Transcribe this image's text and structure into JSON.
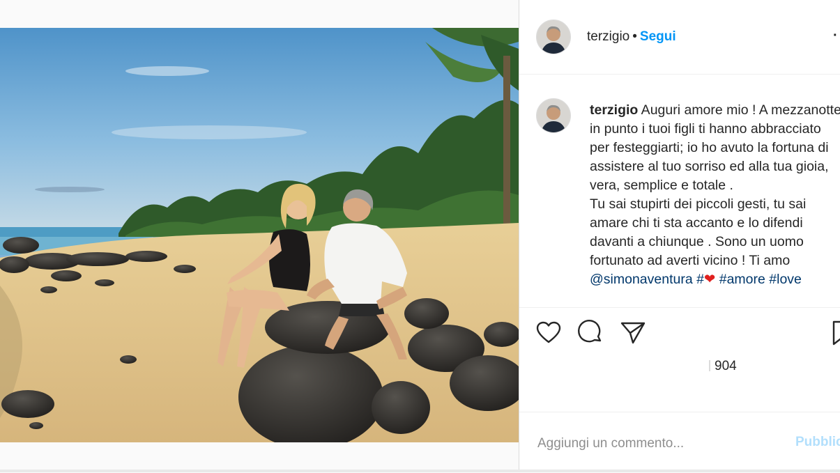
{
  "post": {
    "username": "terzigio",
    "separator": "•",
    "follow_label": "Segui",
    "more_icon": "more-options-icon"
  },
  "caption": {
    "username": "terzigio",
    "text_part1": " Auguri amore mio ! A mezzanotte in punto i tuoi figli ti hanno abbracciato per festeggiarti; io ho avuto la fortuna di assistere al tuo sorriso ed alla tua gioia, vera, semplice e totale .\nTu sai stupirti dei piccoli gesti, tu sai amare chi ti sta accanto e lo difendi davanti a chiunque . Sono un uomo fortunato ad averti vicino ! Ti amo\n",
    "mention": "@simonaventura",
    "hashtag_heart_prefix": " #",
    "heart": "❤",
    "hashtag1": " #amore",
    "hashtag2": " #love"
  },
  "actions": {
    "like_icon": "heart-icon",
    "comment_icon": "comment-icon",
    "share_icon": "share-icon",
    "save_icon": "bookmark-icon"
  },
  "likes": {
    "count": "904"
  },
  "comment": {
    "placeholder": "Aggiungi un commento...",
    "publish_label": "Pubblica"
  },
  "colors": {
    "accent": "#0095f6",
    "publish_disabled": "#b2dffc",
    "text": "#262626",
    "link": "#00376b"
  }
}
